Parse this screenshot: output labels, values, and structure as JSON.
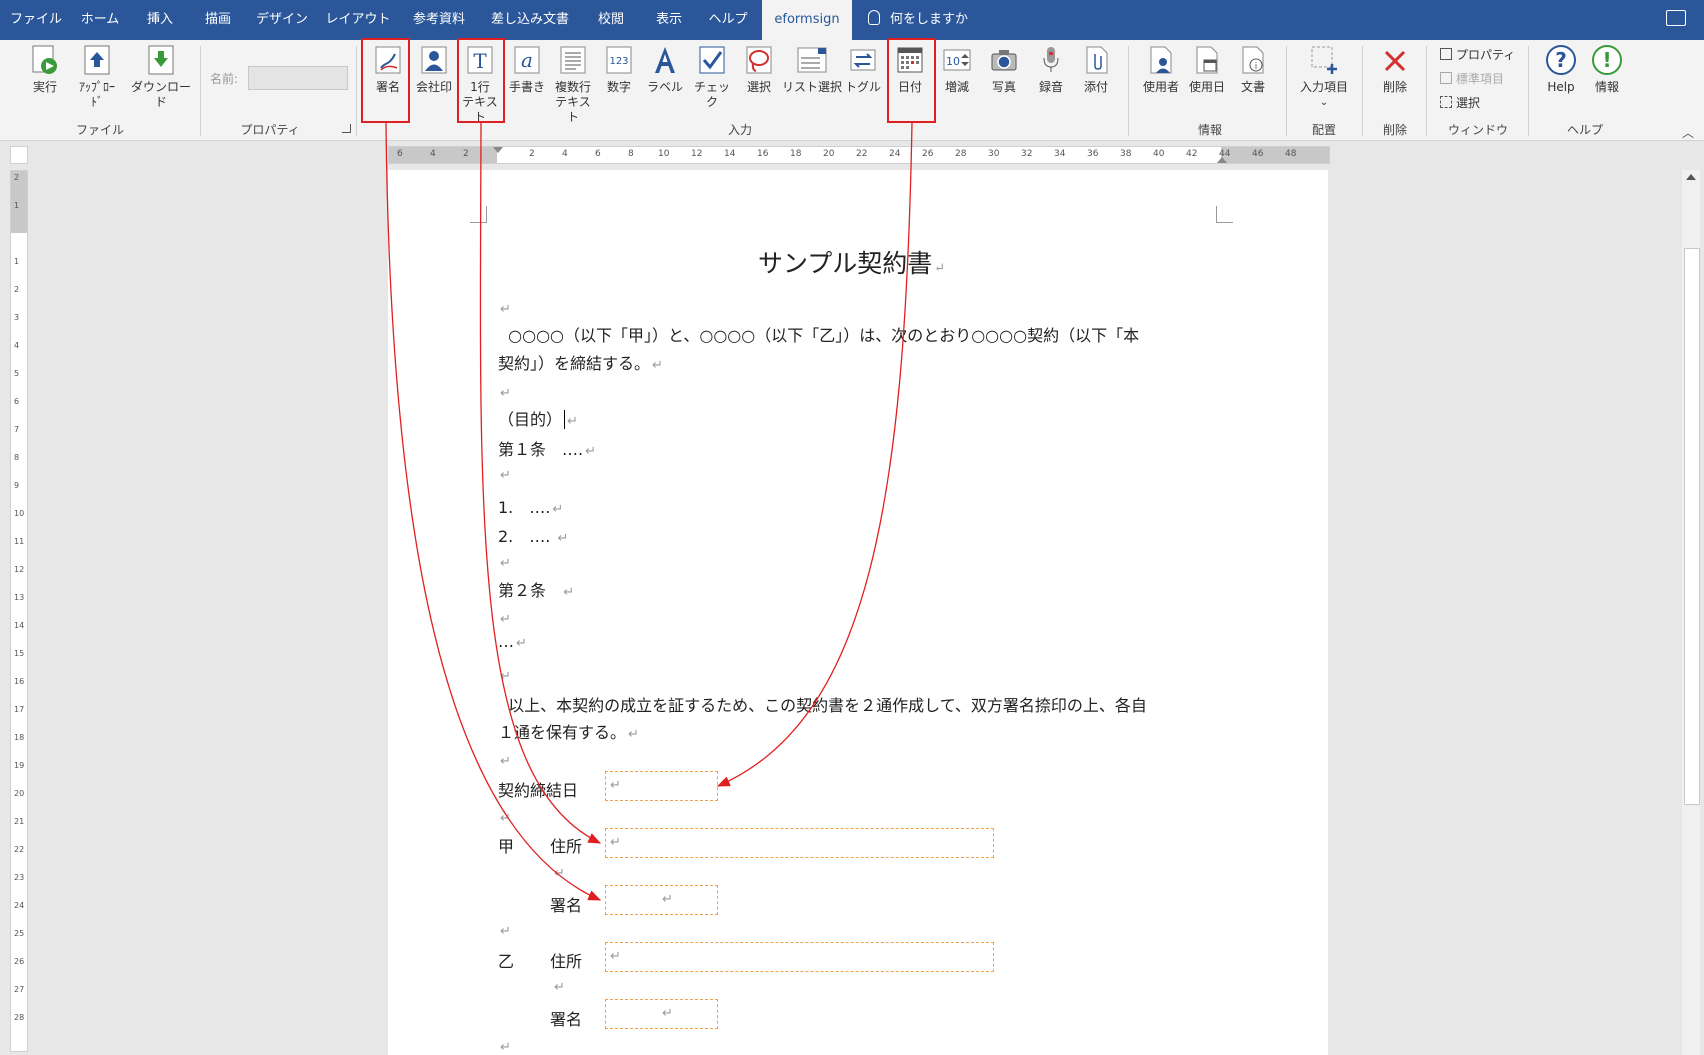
{
  "tabs": [
    "ファイル",
    "ホーム",
    "挿入",
    "描画",
    "デザイン",
    "レイアウト",
    "参考資料",
    "差し込み文書",
    "校閲",
    "表示",
    "ヘルプ",
    "eformsign"
  ],
  "active_tab": "eformsign",
  "tell_me": "何をしますか",
  "ribbon": {
    "file_group": {
      "run": "実行",
      "upload": "ｱｯﾌﾟﾛｰﾄﾞ",
      "download": "ダウンロード",
      "label": "ファイル"
    },
    "property_group": {
      "name_label": "名前:",
      "name_value": "",
      "label": "プロパティ"
    },
    "input_group": {
      "signature": "署名",
      "company_seal": "会社印",
      "one_line_1": "1行",
      "one_line_2": "テキスト",
      "handwriting": "手書き",
      "multi_line_1": "複数行",
      "multi_line_2": "テキスト",
      "number": "数字",
      "number_icon": "123",
      "label_btn": "ラベル",
      "check": "チェック",
      "select": "選択",
      "list_select": "リスト選択",
      "toggle": "トグル",
      "date": "日付",
      "stepper": "増減",
      "stepper_icon": "10",
      "photo": "写真",
      "record": "録音",
      "attach": "添付",
      "label": "入力"
    },
    "info_group": {
      "user": "使用者",
      "use_date": "使用日",
      "document": "文書",
      "label": "情報"
    },
    "layout_group": {
      "input_item": "入力項目",
      "label": "配置"
    },
    "delete_group": {
      "delete": "削除",
      "label": "削除"
    },
    "window_group": {
      "property": "プロパティ",
      "standard": "標準項目",
      "select": "選択",
      "label": "ウィンドウ"
    },
    "help_group": {
      "help": "Help",
      "info": "情報",
      "label": "ヘルプ"
    }
  },
  "ruler_h": [
    "6",
    "4",
    "2",
    "2",
    "4",
    "6",
    "8",
    "10",
    "12",
    "14",
    "16",
    "18",
    "20",
    "22",
    "24",
    "26",
    "28",
    "30",
    "32",
    "34",
    "36",
    "38",
    "40",
    "42",
    "44",
    "46",
    "48"
  ],
  "ruler_v": [
    "2",
    "1",
    "1",
    "2",
    "3",
    "4",
    "5",
    "6",
    "7",
    "8",
    "9",
    "10",
    "11",
    "12",
    "13",
    "14",
    "15",
    "16",
    "17",
    "18",
    "19",
    "20",
    "21",
    "22",
    "23",
    "24",
    "25",
    "26",
    "27",
    "28"
  ],
  "doc": {
    "title": "サンプル契約書",
    "p1a": "○○○○（以下「甲」）と、○○○○（以下「乙」）は、次のとおり○○○○契約（以下「本",
    "p1b": "契約」）を締結する。",
    "purpose": "（目的）",
    "art1": "第１条　….",
    "item1": "1.　….",
    "item2": "2.　….",
    "art2": "第２条",
    "dots": "…",
    "p2a": "以上、本契約の成立を証するため、この契約書を２通作成して、双方署名捺印の上、各自",
    "p2b": "１通を保有する。",
    "contract_date": "契約締結日",
    "party_a": "甲",
    "party_b": "乙",
    "address": "住所",
    "signature": "署名",
    "ret": "↵"
  }
}
